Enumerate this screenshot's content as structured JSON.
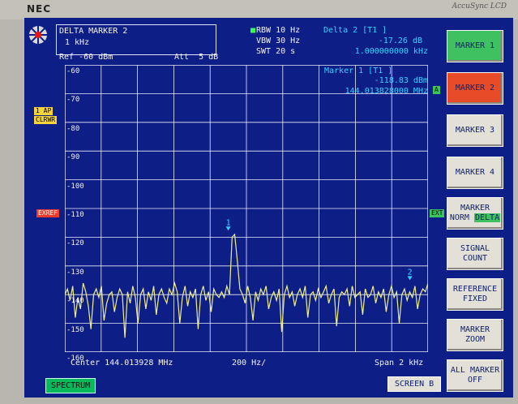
{
  "bezel": {
    "brand": "NEC",
    "model": "AccuSync LCD"
  },
  "header": {
    "marker_title": "DELTA MARKER 2",
    "marker_freq": "1 kHz",
    "ref": "Ref -60 dBm",
    "att": "Att  5 dB",
    "rbw": "RBW 10 Hz",
    "vbw": "VBW 30 Hz",
    "swt": "SWT 20 s",
    "delta_title": "Delta 2 [T1 ]",
    "delta_level": "-17.26 dB",
    "delta_freq": "1.000000000 kHz"
  },
  "marker1": {
    "title": "Marker 1 [T1 ]",
    "level": "-118.83 dBm",
    "freq": "144.013828000 MHz"
  },
  "side_labels": {
    "trace": "1 AP",
    "clrwr": "CLRWR",
    "exref": "EXREF",
    "a": "A",
    "ext": "EXT"
  },
  "y_ticks": [
    "-60",
    "-70",
    "-80",
    "-90",
    "-100",
    "-110",
    "-120",
    "-130",
    "-140",
    "-150",
    "-160"
  ],
  "footer": {
    "center": "Center 144.013928 MHz",
    "div": "200 Hz/",
    "span": "Span 2 kHz"
  },
  "softkeys": {
    "marker1": "MARKER 1",
    "marker2": "MARKER 2",
    "marker3": "MARKER 3",
    "marker4": "MARKER 4",
    "marker_norm_delta_1": "MARKER",
    "marker_norm": "NORM",
    "marker_delta": "DELTA",
    "signal_count_1": "SIGNAL",
    "signal_count_2": "COUNT",
    "reference_fixed_1": "REFERENCE",
    "reference_fixed_2": "FIXED",
    "marker_zoom_1": "MARKER",
    "marker_zoom_2": "ZOOM",
    "all_marker_off_1": "ALL MARKER",
    "all_marker_off_2": "OFF"
  },
  "status": {
    "spectrum": "SPECTRUM",
    "screen_b": "SCREEN B"
  },
  "markers": {
    "m1": "1",
    "m2": "2"
  },
  "chart_data": {
    "type": "line",
    "xlabel": "",
    "ylabel": "",
    "x_range": [
      144.012928,
      144.014928
    ],
    "ylim": [
      -160,
      -60
    ],
    "grid": true,
    "series": [
      {
        "values": [
          -140,
          -138,
          -142,
          -137,
          -148,
          -141,
          -145,
          -136,
          -139,
          -144,
          -152,
          -140,
          -138,
          -141,
          -137,
          -149,
          -143,
          -140,
          -139,
          -146,
          -141,
          -138,
          -140,
          -155,
          -139,
          -143,
          -137,
          -141,
          -150,
          -140,
          -138,
          -145,
          -139,
          -142,
          -137,
          -147,
          -140,
          -138,
          -141,
          -143,
          -138,
          -140,
          -136,
          -139,
          -150,
          -141,
          -137,
          -144,
          -139,
          -141,
          -138,
          -152,
          -140,
          -137,
          -142,
          -139,
          -146,
          -138,
          -140,
          -141,
          -139,
          -141,
          -137,
          -140,
          -120,
          -119,
          -128,
          -138,
          -140,
          -143,
          -137,
          -141,
          -149,
          -139,
          -142,
          -138,
          -140,
          -137,
          -145,
          -141,
          -139,
          -142,
          -138,
          -153,
          -140,
          -137,
          -141,
          -139,
          -144,
          -140,
          -138,
          -141,
          -137,
          -148,
          -140,
          -139,
          -142,
          -138,
          -141,
          -139,
          -137,
          -143,
          -140,
          -138,
          -151,
          -141,
          -139,
          -140,
          -138,
          -144,
          -137,
          -141,
          -140,
          -139,
          -147,
          -138,
          -141,
          -140,
          -137,
          -143,
          -139,
          -141,
          -138,
          -146,
          -140,
          -137,
          -141,
          -139,
          -150,
          -140,
          -138,
          -142,
          -139,
          -141,
          -137,
          -145,
          -140,
          -138,
          -139,
          -136
        ]
      }
    ],
    "markers": [
      {
        "label": "1",
        "x": 144.013828,
        "y": -118.83
      },
      {
        "label": "2",
        "x": 144.014828,
        "y": -136.09
      }
    ]
  }
}
